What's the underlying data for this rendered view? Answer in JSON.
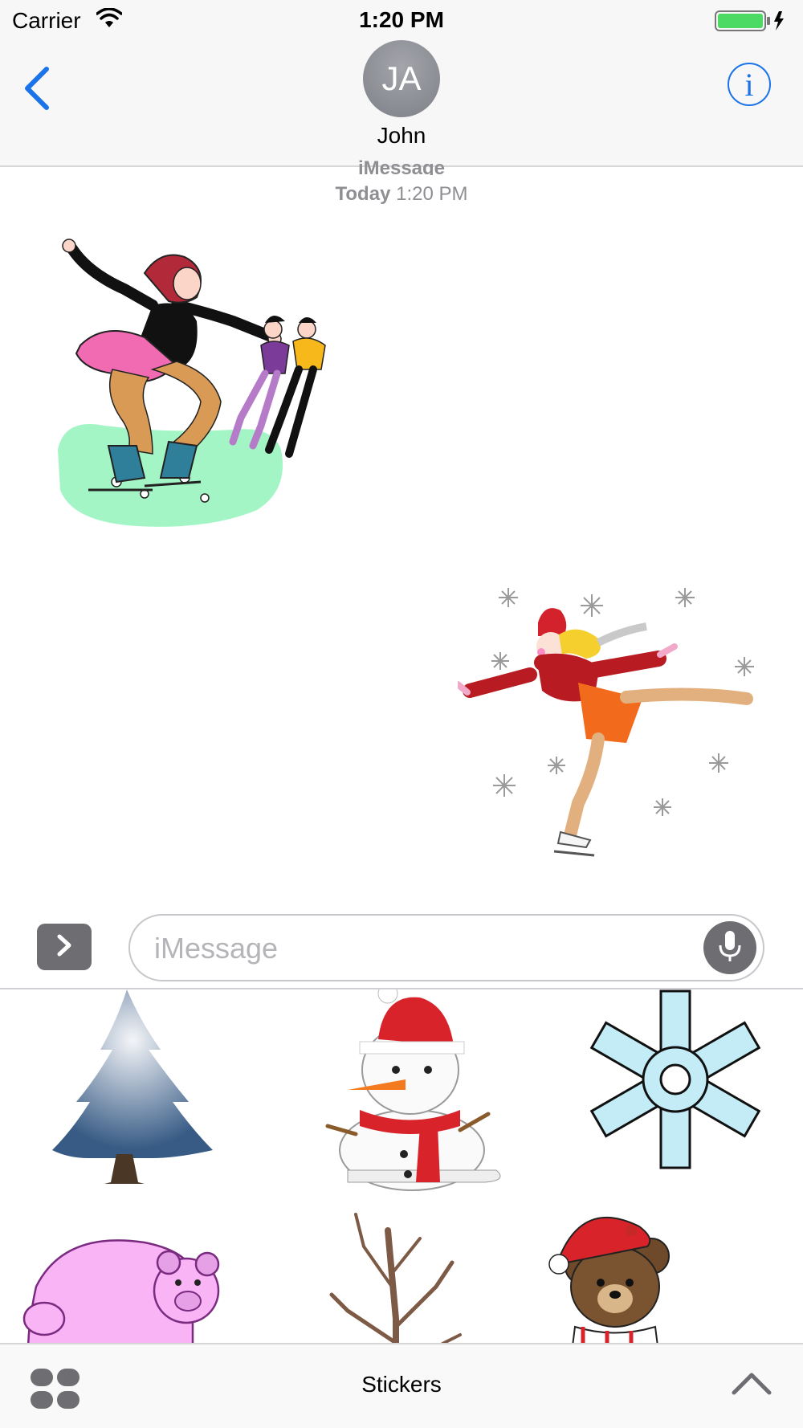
{
  "status_bar": {
    "carrier": "Carrier",
    "time": "1:20 PM",
    "battery_color": "#4cd964"
  },
  "nav": {
    "contact_initials": "JA",
    "contact_name": "John",
    "accent": "#1a73e8"
  },
  "thread": {
    "service": "iMessage",
    "day": "Today",
    "time": "1:20 PM",
    "stickers": [
      {
        "name": "figure-skaters-sticker",
        "direction": "received"
      },
      {
        "name": "ice-skater-girl-sticker",
        "direction": "sent"
      }
    ]
  },
  "composer": {
    "placeholder": "iMessage"
  },
  "drawer": {
    "items": [
      "pine-tree",
      "snowman",
      "snowflake",
      "pink-bear",
      "bare-tree",
      "teddy-bear-santa-hat"
    ]
  },
  "bottom_bar": {
    "title": "Stickers"
  }
}
